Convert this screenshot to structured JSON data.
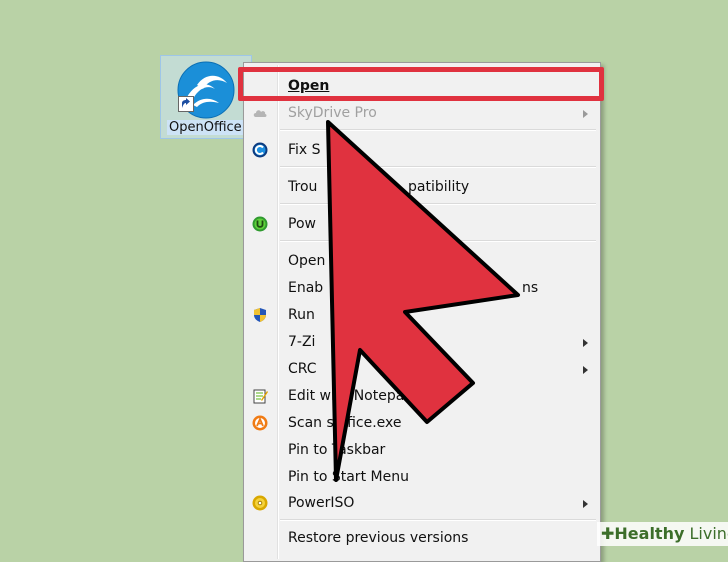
{
  "desktop": {
    "icon_label": "OpenOffice"
  },
  "menu": {
    "items": [
      {
        "label": "Open",
        "bold": true,
        "disabled": false,
        "submenu": false,
        "icon": ""
      },
      {
        "label": "SkyDrive Pro",
        "bold": false,
        "disabled": true,
        "submenu": true,
        "icon": "cloud-icon"
      },
      {
        "label": "Fix S",
        "bold": false,
        "disabled": false,
        "submenu": false,
        "icon": "ccleaner-icon"
      },
      {
        "label": "Trou",
        "suffix": "patibility",
        "bold": false,
        "disabled": false,
        "submenu": false,
        "icon": ""
      },
      {
        "label": "Pow",
        "bold": false,
        "disabled": false,
        "submenu": false,
        "icon": "uniblue-icon"
      },
      {
        "label": "Open",
        "bold": false,
        "disabled": false,
        "submenu": false,
        "icon": ""
      },
      {
        "label": "Enab",
        "suffix": "ns",
        "bold": false,
        "disabled": false,
        "submenu": false,
        "icon": ""
      },
      {
        "label": "Run",
        "bold": false,
        "disabled": false,
        "submenu": false,
        "icon": "uac-shield-icon"
      },
      {
        "label": "7-Zi",
        "bold": false,
        "disabled": false,
        "submenu": true,
        "icon": ""
      },
      {
        "label": "CRC",
        "suffix": "A",
        "bold": false,
        "disabled": false,
        "submenu": true,
        "icon": ""
      },
      {
        "label": "Edit with Notepad++",
        "bold": false,
        "disabled": false,
        "submenu": false,
        "icon": "notepadpp-icon"
      },
      {
        "label": "Scan soffice.exe",
        "bold": false,
        "disabled": false,
        "submenu": false,
        "icon": "avast-icon"
      },
      {
        "label": "Pin to Taskbar",
        "bold": false,
        "disabled": false,
        "submenu": false,
        "icon": ""
      },
      {
        "label": "Pin to Start Menu",
        "bold": false,
        "disabled": false,
        "submenu": false,
        "icon": ""
      },
      {
        "label": "PowerISO",
        "bold": false,
        "disabled": false,
        "submenu": true,
        "icon": "poweriso-icon"
      },
      {
        "label": "Restore previous versions",
        "bold": false,
        "disabled": false,
        "submenu": false,
        "icon": ""
      }
    ]
  },
  "watermark": {
    "bold": "Healthy",
    "rest": " Living"
  },
  "colors": {
    "desktop_bg": "#b9d2a6",
    "highlight": "#e0323f",
    "arrow": "#e0323f"
  }
}
